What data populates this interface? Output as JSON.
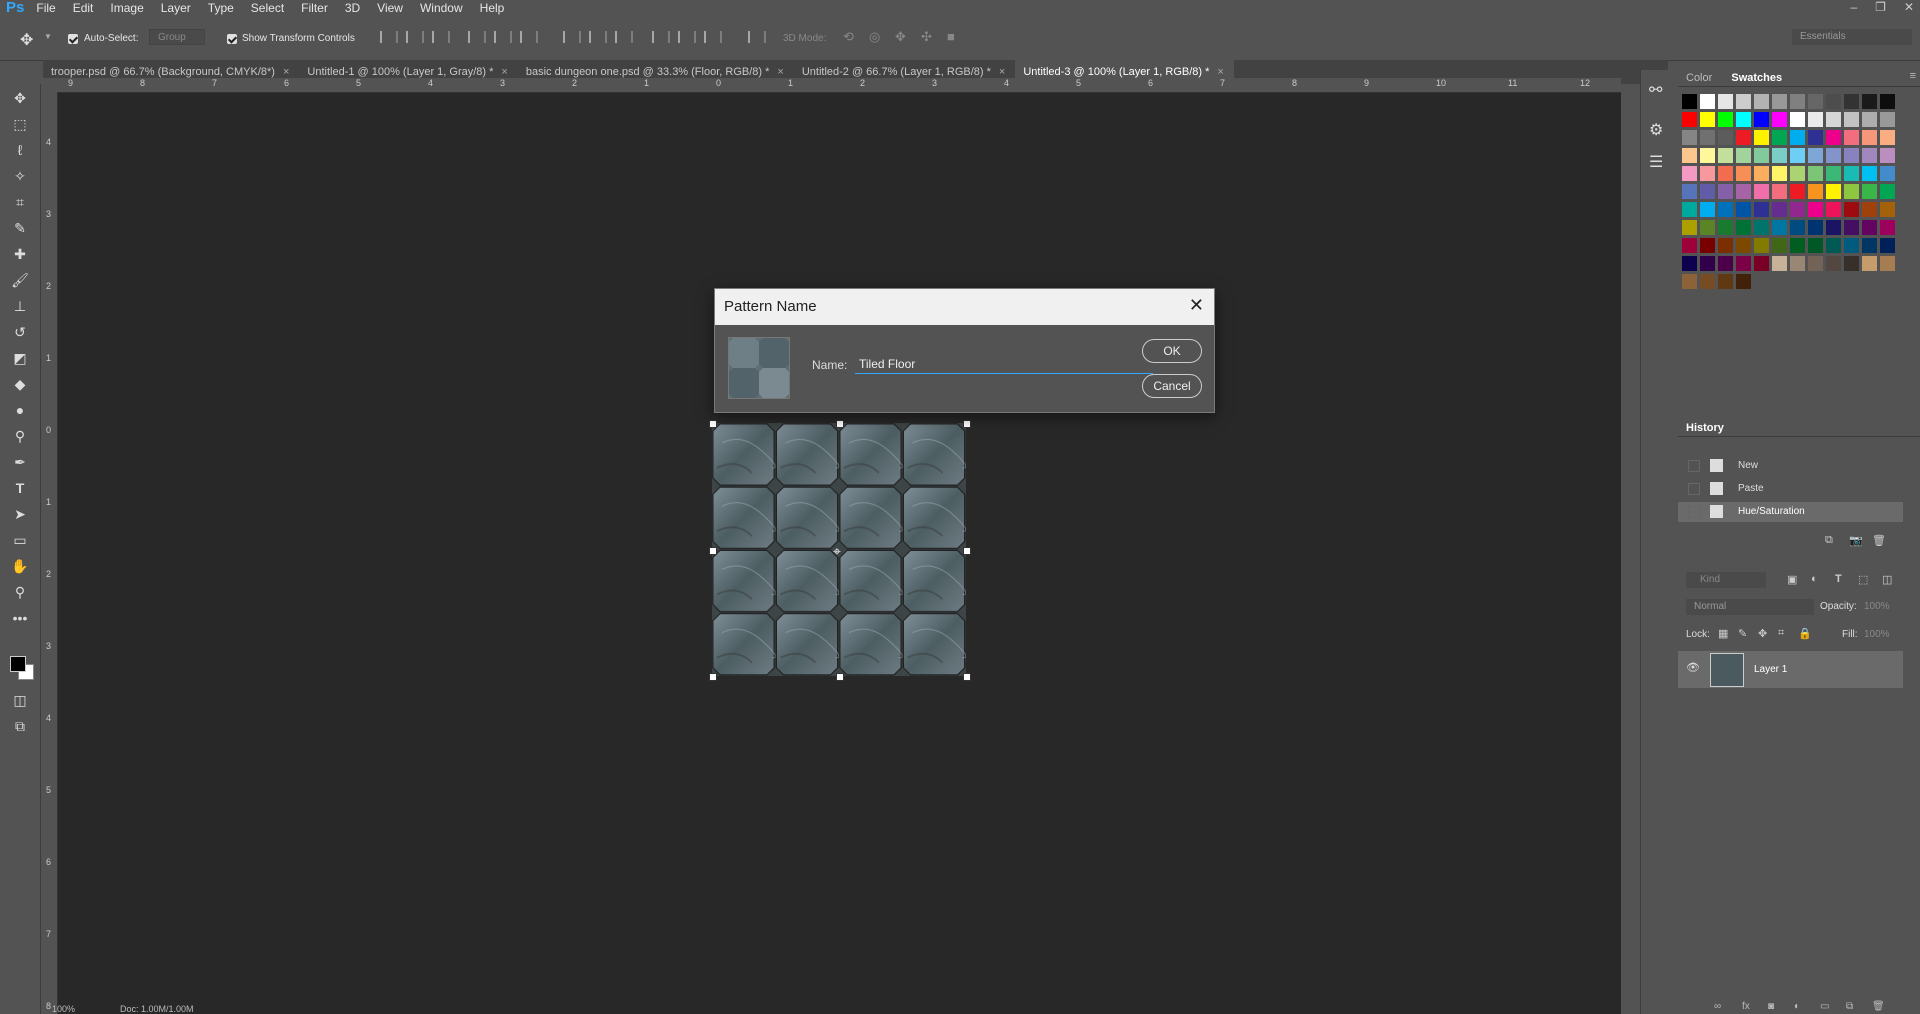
{
  "app": {
    "logo": "Ps"
  },
  "menu": [
    "File",
    "Edit",
    "Image",
    "Layer",
    "Type",
    "Select",
    "Filter",
    "3D",
    "View",
    "Window",
    "Help"
  ],
  "options": {
    "auto_select_label": "Auto-Select:",
    "auto_select_value": "Group",
    "show_transform_label": "Show Transform Controls",
    "mode_3d_label": "3D Mode:",
    "workspace": "Essentials"
  },
  "tabs": [
    {
      "label": "trooper.psd @ 66.7% (Background, CMYK/8*)",
      "close": "×"
    },
    {
      "label": "Untitled-1 @ 100% (Layer 1, Gray/8) *",
      "close": "×"
    },
    {
      "label": "basic dungeon one.psd @ 33.3% (Floor, RGB/8) *",
      "close": "×"
    },
    {
      "label": "Untitled-2 @ 66.7% (Layer 1, RGB/8) *",
      "close": "×"
    },
    {
      "label": "Untitled-3 @ 100% (Layer 1, RGB/8) *",
      "close": "×"
    }
  ],
  "ruler": {
    "h": [
      "9",
      "8",
      "7",
      "6",
      "5",
      "4",
      "3",
      "2",
      "1",
      "0",
      "1",
      "2",
      "3",
      "4",
      "5",
      "6",
      "7",
      "8",
      "9",
      "10",
      "11",
      "12"
    ],
    "v": [
      "4",
      "3",
      "2",
      "1",
      "0",
      "1",
      "2",
      "3",
      "4",
      "5",
      "6",
      "7",
      "8"
    ]
  },
  "dialog": {
    "title": "Pattern Name",
    "close": "✕",
    "name_label": "Name:",
    "name_value": "Tiled Floor",
    "ok": "OK",
    "cancel": "Cancel"
  },
  "panels": {
    "color_tab": "Color",
    "swatches_tab": "Swatches",
    "history_title": "History",
    "history_items": [
      "New",
      "Paste",
      "Hue/Saturation"
    ],
    "kind_placeholder": "Kind",
    "blend_mode": "Normal",
    "opacity_label": "Opacity:",
    "opacity_value": "100%",
    "lock_label": "Lock:",
    "fill_label": "Fill:",
    "fill_value": "100%",
    "layer_name": "Layer 1"
  },
  "status": {
    "zoom": "100%",
    "doc": "Doc: 1.00M/1.00M"
  },
  "colors": {
    "accent": "#31a8ff",
    "swatches": [
      "#000000",
      "#ffffff",
      "#e6e6e6",
      "#cccccc",
      "#b3b3b3",
      "#999999",
      "#808080",
      "#666666",
      "#4d4d4d",
      "#333333",
      "#1a1a1a",
      "#0d0d0d",
      "#ff0000",
      "#ffff00",
      "#00ff00",
      "#00ffff",
      "#0000ff",
      "#ff00ff",
      "#ffffff",
      "#ebebeb",
      "#d6d6d6",
      "#c2c2c2",
      "#adadad",
      "#999999",
      "#858585",
      "#707070",
      "#5c5c5c",
      "#ed1c24",
      "#fff200",
      "#00a651",
      "#00aeef",
      "#2e3192",
      "#ec008c",
      "#f26d7d",
      "#f7977a",
      "#fbad82",
      "#fdc68c",
      "#fff799",
      "#c4df9b",
      "#a2d39c",
      "#82ca9c",
      "#7bcdc8",
      "#6ecff6",
      "#7ea7d8",
      "#8493ca",
      "#8882be",
      "#a187be",
      "#bc8dbf",
      "#f49ac2",
      "#f6989d",
      "#f26c4f",
      "#f68e56",
      "#fbaf5c",
      "#fff467",
      "#acd372",
      "#7cc576",
      "#3bb878",
      "#1abbb4",
      "#00bff3",
      "#438ccb",
      "#5574b9",
      "#605ca8",
      "#855fa8",
      "#a763a8",
      "#f06ea9",
      "#f26d7d",
      "#ed1c24",
      "#f7941d",
      "#fff200",
      "#8dc63f",
      "#39b54a",
      "#00a651",
      "#00a99d",
      "#00aeef",
      "#0072bc",
      "#0054a6",
      "#2e3192",
      "#662d91",
      "#92278f",
      "#ec008c",
      "#ed145b",
      "#9e0b0f",
      "#a0410d",
      "#a36209",
      "#aba000",
      "#598527",
      "#1a7b30",
      "#007236",
      "#00746b",
      "#0076a3",
      "#004b80",
      "#003471",
      "#1b1464",
      "#440e62",
      "#630460",
      "#9e005d",
      "#9e0039",
      "#790000",
      "#7b2e00",
      "#7d4900",
      "#827b00",
      "#406618",
      "#005e20",
      "#005826",
      "#005952",
      "#005b7f",
      "#003663",
      "#002157",
      "#0d004c",
      "#32004b",
      "#4b0049",
      "#7b0046",
      "#7a0026",
      "#c7b299",
      "#998675",
      "#736357",
      "#534741",
      "#37302a",
      "#c69c6d",
      "#a67c52",
      "#8c6239",
      "#754c24",
      "#603913",
      "#42210b"
    ]
  }
}
